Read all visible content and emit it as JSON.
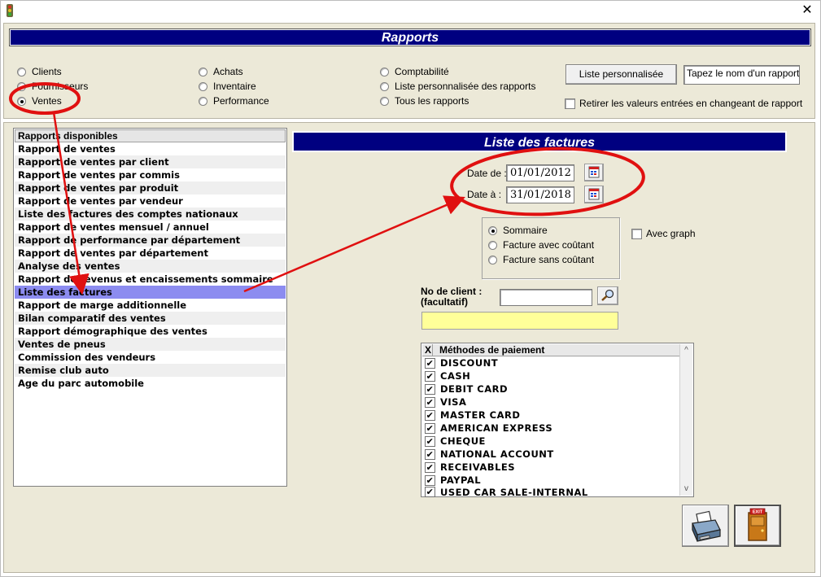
{
  "window": {
    "close_glyph": "✕",
    "icon": "traffic-light-icon"
  },
  "header": {
    "title": "Rapports"
  },
  "categories": {
    "col1": [
      {
        "label": "Clients",
        "checked": false
      },
      {
        "label": "Fournisseurs",
        "checked": false
      },
      {
        "label": "Ventes",
        "checked": true
      }
    ],
    "col2": [
      {
        "label": "Achats",
        "checked": false
      },
      {
        "label": "Inventaire",
        "checked": false
      },
      {
        "label": "Performance",
        "checked": false
      }
    ],
    "col3": [
      {
        "label": "Comptabilité",
        "checked": false
      },
      {
        "label": "Liste personnalisée des rapports",
        "checked": false
      },
      {
        "label": "Tous les rapports",
        "checked": false
      }
    ]
  },
  "custom_list": {
    "button_label": "Liste personnalisée",
    "report_name_value": "Tapez le nom d'un rapport",
    "clear_values_label": "Retirer les valeurs entrées en changeant de rapport"
  },
  "reports": {
    "header": "Rapports disponibles",
    "items": [
      "Rapport de ventes",
      "Rapport de ventes par client",
      "Rapport de ventes par commis",
      "Rapport de ventes par produit",
      "Rapport de ventes par vendeur",
      "Liste des factures des comptes nationaux",
      "Rapport de ventes mensuel / annuel",
      "Rapport de performance par département",
      "Rapport de ventes par département",
      "Analyse des ventes",
      "Rapport de revenus et encaissements sommaire",
      "Liste des factures",
      "Rapport de marge additionnelle",
      "Bilan comparatif des ventes",
      "Rapport démographique des ventes",
      "Ventes de pneus",
      "Commission des vendeurs",
      "Remise club auto",
      "Age du parc automobile"
    ],
    "selected": "Liste des factures"
  },
  "detail": {
    "title": "Liste des factures",
    "date_from_label": "Date de :",
    "date_from_value": "01/01/2012",
    "date_to_label": "Date à :",
    "date_to_value": "31/01/2018",
    "options": [
      {
        "label": "Sommaire",
        "checked": true
      },
      {
        "label": "Facture avec coûtant",
        "checked": false
      },
      {
        "label": "Facture sans coûtant",
        "checked": false
      }
    ],
    "graph_label": "Avec graph",
    "client_label_line1": "No de client :",
    "client_label_line2": "(facultatif)",
    "client_value": "",
    "client_name_value": ""
  },
  "payments": {
    "header_x": "X",
    "header_label": "Méthodes de paiement",
    "check_glyph": "✔",
    "items": [
      "DISCOUNT",
      "CASH",
      "DEBIT CARD",
      "VISA",
      "MASTER CARD",
      "AMERICAN EXPRESS",
      "CHEQUE",
      "NATIONAL ACCOUNT",
      "RECEIVABLES",
      "PAYPAL",
      "USED CAR SALE-INTERNAL"
    ],
    "scroll_up": "^",
    "scroll_down": "v"
  },
  "actions": {
    "print_icon": "printer-icon",
    "exit_icon": "exit-door-icon",
    "exit_sign": "EXIT"
  },
  "colors": {
    "title_bar": "#000080",
    "panel": "#ece9d8",
    "selected_row": "#8c8cf0",
    "client_name_field": "#ffff99",
    "annotation": "#e01010"
  }
}
